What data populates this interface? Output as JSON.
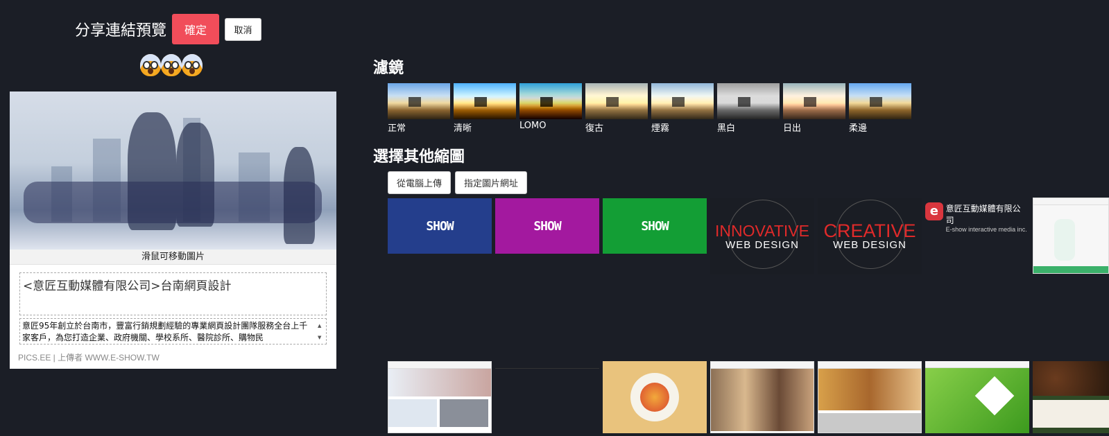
{
  "header": {
    "title": "分享連結預覽",
    "confirm_label": "確定",
    "cancel_label": "取消"
  },
  "preview": {
    "drag_hint": "滑鼠可移動圖片",
    "title_text": "<意匠互動媒體有限公司>台南網頁設計",
    "description": "意匠95年創立於台南市，豐富行銷規劃經驗的專業網頁設計團隊服務全台上千家客戶，為您打造企業、政府機關、學校系所、醫院診所、購物民",
    "footer": "PICS.EE | 上傳者 WWW.E-SHOW.TW"
  },
  "filters": {
    "title": "濾鏡",
    "items": [
      {
        "label": "正常"
      },
      {
        "label": "清晰"
      },
      {
        "label": "LOMO"
      },
      {
        "label": "復古"
      },
      {
        "label": "煙霧"
      },
      {
        "label": "黑白"
      },
      {
        "label": "日出"
      },
      {
        "label": "柔邊"
      }
    ]
  },
  "thumbnails": {
    "title": "選擇其他縮圖",
    "upload_label": "從電腦上傳",
    "url_label": "指定圖片網址",
    "show_text": "SHOW",
    "innovative": "INNOVATIVE",
    "creative": "CREATIVE",
    "web_design": "WEB DESIGN",
    "logo_name": "意匠互動媒體有限公司",
    "logo_sub": "E-show interactive media inc.",
    "colors": {
      "blue": "#243e8c",
      "magenta": "#a3199f",
      "green": "#139e35"
    }
  }
}
